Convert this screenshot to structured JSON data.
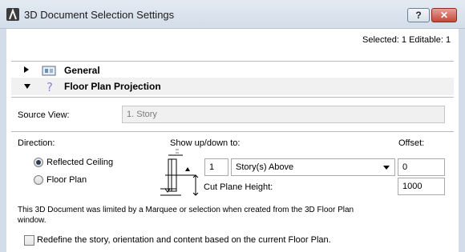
{
  "window": {
    "title": "3D Document Selection Settings",
    "help_label": "?",
    "close_label": "✕"
  },
  "selection_info": "Selected: 1 Editable: 1",
  "sections": {
    "general_label": "General",
    "floor_plan_projection_label": "Floor Plan Projection",
    "help_glyph": "?"
  },
  "source_view": {
    "label": "Source View:",
    "value": "1. Story"
  },
  "direction": {
    "label": "Direction:",
    "options": [
      "Reflected Ceiling",
      "Floor Plan"
    ],
    "selected": "Reflected Ceiling"
  },
  "show_updown": {
    "label": "Show up/down to:",
    "count_value": "1",
    "story_select": "Story(s) Above",
    "offset_label": "Offset:",
    "offset_value": "0",
    "cut_plane_label": "Cut Plane Height:",
    "cut_plane_value": "1000"
  },
  "info_text": {
    "line1": "This 3D Document was limited by a Marquee or selection when created from the 3D Floor Plan",
    "line2": "window."
  },
  "redefine_option": {
    "label": "Redefine the story, orientation and content based on the current Floor Plan.",
    "checked": false
  },
  "icons": {
    "app": "archicad-icon",
    "general": "general-settings-icon",
    "help": "help-icon",
    "cut_plane_diagram": "cut-plane-height-diagram"
  },
  "colors": {
    "titlebar": "#d3dde9",
    "close_button": "#c4473a",
    "section_highlight": "#f1f1f1"
  }
}
